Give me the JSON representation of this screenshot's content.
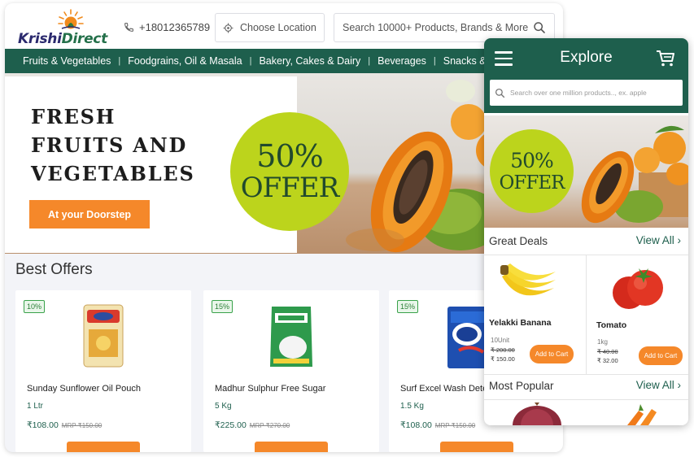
{
  "brand": {
    "name_part1": "Krishi",
    "name_part2": "Direct"
  },
  "header": {
    "phone": "+18012365789",
    "location_label": "Choose Location",
    "search_placeholder": "Search 10000+ Products, Brands & More"
  },
  "categories": [
    "Fruits & Vegetables",
    "Foodgrains, Oil & Masala",
    "Bakery, Cakes & Dairy",
    "Beverages",
    "Snacks &"
  ],
  "hero": {
    "title_lines": [
      "FRESH",
      "FRUITS AND",
      "VEGETABLES"
    ],
    "cta_label": "At your Doorstep",
    "offer_pct": "50%",
    "offer_word": "OFFER"
  },
  "best_offers": {
    "title": "Best Offers",
    "products": [
      {
        "discount": "10%",
        "name": "Sunday Sunflower Oil Pouch",
        "qty": "1 Ltr",
        "price": "₹108.00",
        "mrp": "MRP ₹150.00"
      },
      {
        "discount": "15%",
        "name": "Madhur Sulphur Free Sugar",
        "qty": "5 Kg",
        "price": "₹225.00",
        "mrp": "MRP ₹270.00"
      },
      {
        "discount": "15%",
        "name": "Surf Excel Wash Dete",
        "qty": "1.5 Kg",
        "price": "₹108.00",
        "mrp": "MRP ₹150.00"
      }
    ]
  },
  "mobile": {
    "title": "Explore",
    "search_placeholder": "Search over one million products.., ex. apple",
    "offer_pct": "50%",
    "offer_word": "OFFER",
    "great_deals": {
      "title": "Great Deals",
      "view_all": "View All",
      "items": [
        {
          "name": "Yelakki Banana",
          "unit": "10Unit",
          "mrp": "₹ 200.00",
          "price": "₹ 150.00",
          "add_label": "Add to Cart"
        },
        {
          "name": "Tomato",
          "unit": "1kg",
          "mrp": "₹ 40.00",
          "price": "₹ 32.00",
          "add_label": "Add to Cart"
        }
      ]
    },
    "most_popular": {
      "title": "Most Popular",
      "view_all": "View All"
    }
  },
  "colors": {
    "brand_green": "#1e5f4d",
    "accent_orange": "#f5882a",
    "offer_lime": "#bcd41c"
  }
}
